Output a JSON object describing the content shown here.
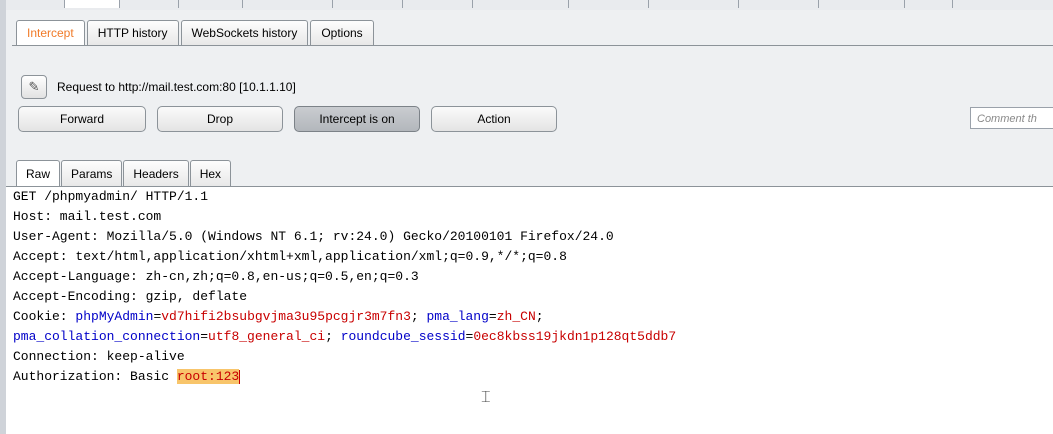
{
  "subtabs": [
    {
      "label": "Intercept",
      "active": true
    },
    {
      "label": "HTTP history",
      "active": false
    },
    {
      "label": "WebSockets history",
      "active": false
    },
    {
      "label": "Options",
      "active": false
    }
  ],
  "request_label": "Request to http://mail.test.com:80  [10.1.1.10]",
  "buttons": {
    "forward": "Forward",
    "drop": "Drop",
    "intercept": "Intercept is on",
    "action": "Action"
  },
  "comment_placeholder": "Comment th",
  "viewtabs": [
    {
      "label": "Raw",
      "active": true
    },
    {
      "label": "Params",
      "active": false
    },
    {
      "label": "Headers",
      "active": false
    },
    {
      "label": "Hex",
      "active": false
    }
  ],
  "request": {
    "line1": "GET /phpmyadmin/ HTTP/1.1",
    "host": "Host: mail.test.com",
    "user_agent": "User-Agent: Mozilla/5.0 (Windows NT 6.1; rv:24.0) Gecko/20100101 Firefox/24.0",
    "accept": "Accept: text/html,application/xhtml+xml,application/xml;q=0.9,*/*;q=0.8",
    "accept_language": "Accept-Language: zh-cn,zh;q=0.8,en-us;q=0.5,en;q=0.3",
    "accept_encoding": "Accept-Encoding: gzip, deflate",
    "cookie_prefix": "Cookie: ",
    "cookie1_name": "phpMyAdmin",
    "cookie1_value": "vd7hifi2bsubgvjma3u95pcgjr3m7fn3",
    "cookie2_name": "pma_lang",
    "cookie2_value": "zh_CN",
    "cookie3_name": "pma_collation_connection",
    "cookie3_value": "utf8_general_ci",
    "cookie4_name": "roundcube_sessid",
    "cookie4_value": "0ec8kbss19jkdn1p128qt5ddb7",
    "connection": "Connection: keep-alive",
    "auth_prefix": "Authorization: Basic ",
    "auth_value": "root:123"
  }
}
